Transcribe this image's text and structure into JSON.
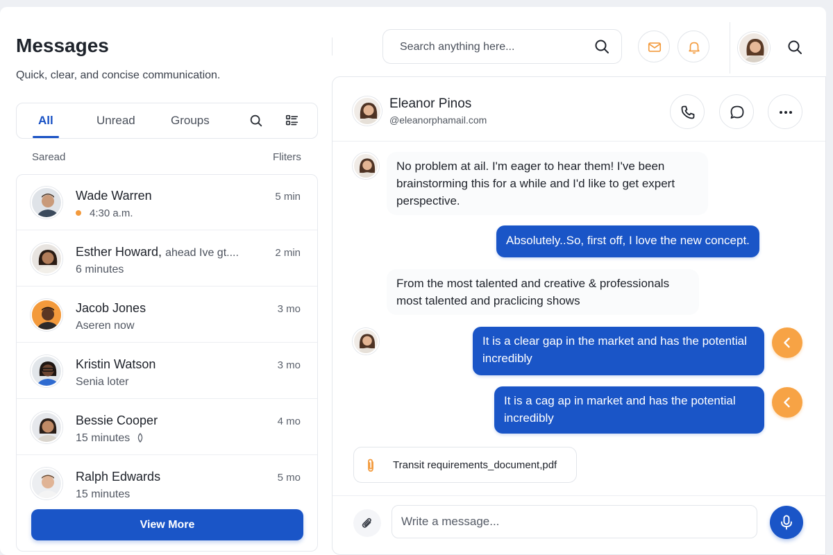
{
  "header": {
    "title": "Messages",
    "subtitle": "Quick, clear, and concise communication."
  },
  "tabs": [
    {
      "label": "All",
      "active": true
    },
    {
      "label": "Unread",
      "active": false
    },
    {
      "label": "Groups",
      "active": false
    }
  ],
  "tab_icons": [
    "search-icon",
    "list-view-icon"
  ],
  "list_header": {
    "left": "Saread",
    "right": "Fliters"
  },
  "contacts": [
    {
      "name": "Wade Warren",
      "extra": "",
      "sub": "4:30 a.m.",
      "time": "5 min",
      "status_dot": true
    },
    {
      "name": "Esther Howard,",
      "extra": "ahead Ive gt....",
      "sub": "6 minutes",
      "time": "2 min"
    },
    {
      "name": "Jacob Jones",
      "extra": "",
      "sub": "Aseren now",
      "time": "3 mo"
    },
    {
      "name": "Kristin Watson",
      "extra": "",
      "sub": "Senia loter",
      "time": "3 mo"
    },
    {
      "name": "Bessie Cooper",
      "extra": "",
      "sub": "15 minutes",
      "time": "4 mo",
      "sub_icon": "pin-icon"
    },
    {
      "name": "Ralph Edwards",
      "extra": "",
      "sub": "15 minutes",
      "time": "5 mo"
    }
  ],
  "view_more": "View More",
  "search": {
    "placeholder": "Search anything here..."
  },
  "chat": {
    "name": "Eleanor Pinos",
    "handle": "@eleanorphamail.com",
    "messages": [
      {
        "from": "them",
        "text": "No problem at ail. I'm eager to hear them! I've been brainstorming this for a while and I'd like to get expert perspective."
      },
      {
        "from": "me",
        "text": "Absolutely..So, first off, I love the new concept."
      },
      {
        "from": "them",
        "text": "From the most talented and creative & professionals most talented and praclicing shows"
      },
      {
        "from": "me",
        "text": "It is a clear gap in the market and has the potential incredibly"
      },
      {
        "from": "me",
        "text": "It is a cag ap in market and has the potential incredibly"
      }
    ],
    "attachment": "Transit requirements_document,pdf",
    "composer_placeholder": "Write a message..."
  },
  "colors": {
    "primary": "#1a55c7",
    "accent_orange": "#f7a345",
    "background": "#eef0f4"
  }
}
